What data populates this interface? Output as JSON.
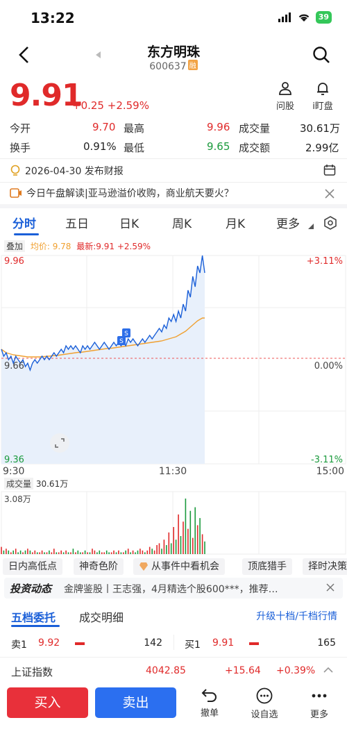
{
  "status": {
    "time": "13:22",
    "battery": "39"
  },
  "header": {
    "title": "东方明珠",
    "code": "600637",
    "tag": "融"
  },
  "quote": {
    "price": "9.91",
    "change": "+0.25",
    "change_pct": "+2.59%",
    "actions": [
      {
        "label": "问股",
        "icon": "ask-icon"
      },
      {
        "label": "i盯盘",
        "icon": "bell-icon"
      }
    ]
  },
  "stats": {
    "open_label": "今开",
    "open": "9.70",
    "high_label": "最高",
    "high": "9.96",
    "volume_label": "成交量",
    "volume": "30.61万",
    "turnover_label": "换手",
    "turnover": "0.91%",
    "low_label": "最低",
    "low": "9.65",
    "amount_label": "成交额",
    "amount": "2.99亿"
  },
  "notices": {
    "report": "2026-04-30 发布财报",
    "news": "今日午盘解读|亚马逊溢价收购，商业航天要火？"
  },
  "tabs": [
    "分时",
    "五日",
    "日K",
    "周K",
    "月K",
    "更多"
  ],
  "chart_meta": {
    "overlay": "叠加",
    "avg_label": "均价: 9.78",
    "latest_label": "最新:9.91",
    "latest_pct": "+2.59%"
  },
  "chart_data": {
    "type": "line",
    "y_top": "9.96",
    "y_mid": "9.66",
    "y_bottom": "9.36",
    "pct_top": "+3.11%",
    "pct_mid": "0.00%",
    "pct_bottom": "-3.11%",
    "x_ticks": [
      "9:30",
      "11:30",
      "15:00"
    ],
    "ylim": [
      9.36,
      9.96
    ],
    "price_series": [
      9.69,
      9.67,
      9.68,
      9.66,
      9.67,
      9.65,
      9.67,
      9.66,
      9.65,
      9.66,
      9.64,
      9.65,
      9.63,
      9.65,
      9.66,
      9.65,
      9.66,
      9.67,
      9.66,
      9.67,
      9.66,
      9.67,
      9.68,
      9.67,
      9.68,
      9.69,
      9.68,
      9.7,
      9.69,
      9.7,
      9.69,
      9.7,
      9.69,
      9.68,
      9.7,
      9.69,
      9.7,
      9.69,
      9.7,
      9.71,
      9.7,
      9.69,
      9.7,
      9.71,
      9.7,
      9.69,
      9.7,
      9.71,
      9.7,
      9.71,
      9.7,
      9.71,
      9.7,
      9.72,
      9.71,
      9.72,
      9.71,
      9.7,
      9.71,
      9.72,
      9.71,
      9.72,
      9.73,
      9.72,
      9.73,
      9.74,
      9.75,
      9.74,
      9.76,
      9.75,
      9.78,
      9.77,
      9.79,
      9.77,
      9.8,
      9.78,
      9.82,
      9.8,
      9.86,
      9.84,
      9.9,
      9.87,
      9.93,
      9.91,
      9.96,
      9.91
    ],
    "avg_series": [
      9.69,
      9.685,
      9.68,
      9.678,
      9.676,
      9.674,
      9.673,
      9.672,
      9.671,
      9.67,
      9.669,
      9.668,
      9.668,
      9.668,
      9.668,
      9.668,
      9.668,
      9.669,
      9.669,
      9.67,
      9.67,
      9.671,
      9.672,
      9.672,
      9.673,
      9.674,
      9.675,
      9.676,
      9.677,
      9.678,
      9.679,
      9.68,
      9.681,
      9.681,
      9.682,
      9.683,
      9.684,
      9.685,
      9.686,
      9.687,
      9.688,
      9.689,
      9.69,
      9.691,
      9.692,
      9.693,
      9.693,
      9.694,
      9.695,
      9.696,
      9.697,
      9.698,
      9.699,
      9.7,
      9.701,
      9.702,
      9.703,
      9.704,
      9.705,
      9.706,
      9.707,
      9.708,
      9.709,
      9.71,
      9.711,
      9.712,
      9.713,
      9.714,
      9.716,
      9.718,
      9.72,
      9.722,
      9.724,
      9.726,
      9.73,
      9.734,
      9.738,
      9.742,
      9.748,
      9.754,
      9.76,
      9.766,
      9.772,
      9.776,
      9.78,
      9.78
    ],
    "volume_label": "成交量",
    "volume_total": "30.61万",
    "volume_max": "3.08万",
    "volume_series": [
      0.4,
      0.2,
      0.3,
      0.2,
      0.1,
      0.2,
      0.3,
      0.1,
      0.2,
      0.1,
      0.2,
      0.3,
      0.2,
      0.1,
      0.2,
      0.1,
      0.1,
      0.2,
      0.1,
      0.1,
      0.2,
      0.1,
      0.3,
      0.1,
      0.1,
      0.2,
      0.1,
      0.2,
      0.1,
      0.1,
      0.3,
      0.1,
      0.2,
      0.1,
      0.1,
      0.2,
      0.1,
      0.1,
      0.3,
      0.2,
      0.1,
      0.2,
      0.1,
      0.1,
      0.2,
      0.1,
      0.1,
      0.2,
      0.1,
      0.2,
      0.1,
      0.1,
      0.2,
      0.3,
      0.1,
      0.2,
      0.1,
      0.2,
      0.3,
      0.2,
      0.1,
      0.2,
      0.4,
      0.3,
      0.2,
      0.5,
      0.6,
      0.3,
      0.8,
      0.5,
      1.2,
      0.6,
      1.5,
      0.8,
      2.2,
      1.0,
      1.8,
      3.08,
      1.4,
      2.4,
      0.9,
      2.6,
      1.6,
      2.0,
      1.1,
      0.7
    ]
  },
  "feature_tabs": [
    "日内高低点",
    "神奇色阶",
    "从事件中看机会",
    "顶底猎手",
    "择时决策"
  ],
  "news": {
    "brand": "投资动态",
    "text": "金牌鉴股丨王志强，4月精选个股600***，推荐…"
  },
  "order_tabs": {
    "tab1": "五档委托",
    "tab2": "成交明细",
    "upgrade": "升级十档/千档行情"
  },
  "order_book": {
    "sell1_label": "卖1",
    "sell1_price": "9.92",
    "sell1_vol": "142",
    "buy1_label": "买1",
    "buy1_price": "9.91",
    "buy1_vol": "165"
  },
  "index": {
    "name": "上证指数",
    "value": "4042.85",
    "change": "+15.64",
    "pct": "+0.39%"
  },
  "bottom": {
    "buy": "买入",
    "sell": "卖出",
    "undo": "撤单",
    "watch": "设自选",
    "more": "更多"
  }
}
